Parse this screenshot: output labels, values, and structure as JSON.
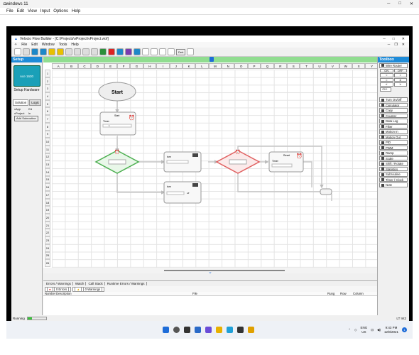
{
  "outer": {
    "title": "windows 11",
    "menu": [
      "File",
      "Edit",
      "View",
      "Input",
      "Options",
      "Help"
    ]
  },
  "app": {
    "title": "Velocio Flow Builder - [C:\\Projects\\vProject\\vProject.viof]",
    "menu": [
      "File",
      "Edit",
      "Window",
      "Tools",
      "Help"
    ],
    "toolbar_label": "Deb"
  },
  "setup": {
    "header": "Setup",
    "hw_text": "Ace 1630",
    "hw_label": "Setup Hardware",
    "tabs": [
      "Solution",
      "Logic"
    ],
    "tree_app": "vApp",
    "tree_edit": "Ed",
    "tree_project": "vProject",
    "tree_sub": "In",
    "add_sub": "Add Subroutine"
  },
  "canvas": {
    "columns": [
      "A",
      "B",
      "C",
      "D",
      "E",
      "F",
      "G",
      "H",
      "I",
      "J",
      "K",
      "L",
      "M",
      "N",
      "O",
      "P",
      "Q",
      "R",
      "S",
      "T",
      "U",
      "V",
      "W",
      "X",
      "Y"
    ],
    "rows": [
      "1",
      "2",
      "3",
      "4",
      "5",
      "6",
      "7",
      "8",
      "9",
      "10",
      "11",
      "12",
      "13",
      "14",
      "15",
      "16",
      "17",
      "18",
      "19",
      "20",
      "21",
      "22",
      "23",
      "24",
      "25",
      "26"
    ],
    "start_label": "Start",
    "start_block_title": "Start",
    "timer_label": "Timer",
    "timer_value": "1",
    "turn_label": "turn",
    "off_label": "off",
    "reset_label": "Reset",
    "timer2_label": "Timer"
  },
  "toolbox": {
    "header": "Toolbox",
    "wire_router": "Wire Router",
    "wr_buttons": [
      "ON",
      "OFF",
      "<",
      ">",
      "=",
      "≠",
      "≤",
      "≥"
    ],
    "wr_extra": "<≥>",
    "items": [
      "Turn On/Off",
      "Calculator",
      "Copy",
      "Counter",
      "Data Log",
      "Filter",
      "Motion In",
      "Motion Out",
      "PID",
      "PWM",
      "Ramp",
      "Scale",
      "Shift / Rotate",
      "Statistics",
      "Subroutine",
      "Timer / Clock",
      "Note"
    ]
  },
  "bottom": {
    "tabs": [
      "Errors / Warnings",
      "Watch",
      "Call Stack",
      "Runtime Errors / Warnings"
    ],
    "errors": "0 Errors",
    "warnings": "0 Warnings",
    "columns": [
      "Number",
      "Description",
      "File",
      "Rung",
      "Row",
      "Column"
    ]
  },
  "status": {
    "text": "Running",
    "progress": 0.25,
    "right": "LT  Int2"
  },
  "taskbar": {
    "lang": "ENG",
    "region": "US",
    "time": "9:43 PM",
    "date": "12/8/2021",
    "notify": "1"
  }
}
